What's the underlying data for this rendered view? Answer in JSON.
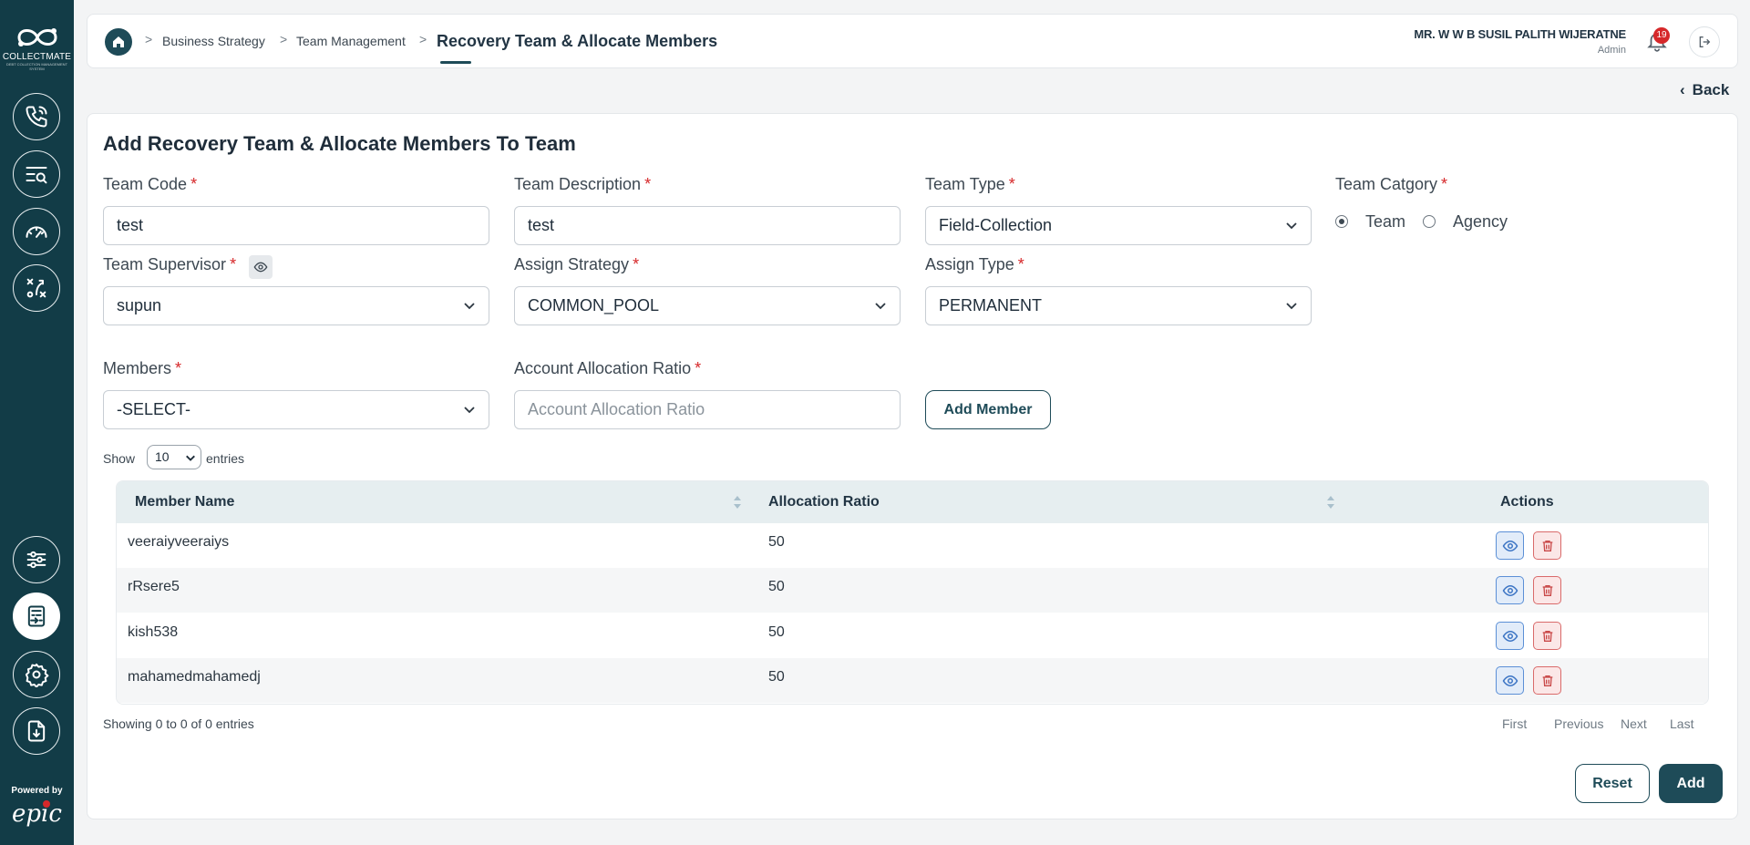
{
  "brand": {
    "name": "COLLECTMATE",
    "tagline": "DEBT COLLECTION MANAGEMENT SYSTEM",
    "powered_by": "Powered by",
    "vendor": "epic"
  },
  "breadcrumb": {
    "items": [
      "Business Strategy",
      "Team Management"
    ],
    "current": "Recovery Team & Allocate Members"
  },
  "user": {
    "name": "MR. W W B SUSIL PALITH WIJERATNE",
    "role": "Admin",
    "notifications": "19"
  },
  "back_label": "Back",
  "form": {
    "title": "Add Recovery Team & Allocate Members To Team",
    "team_code": {
      "label": "Team Code",
      "value": "test"
    },
    "team_description": {
      "label": "Team Description",
      "value": "test"
    },
    "team_type": {
      "label": "Team Type",
      "value": "Field-Collection"
    },
    "team_category": {
      "label": "Team Catgory",
      "options": [
        "Team",
        "Agency"
      ],
      "selected": "Team"
    },
    "team_supervisor": {
      "label": "Team Supervisor",
      "value": "supun"
    },
    "assign_strategy": {
      "label": "Assign Strategy",
      "value": "COMMON_POOL"
    },
    "assign_type": {
      "label": "Assign Type",
      "value": "PERMANENT"
    },
    "members": {
      "label": "Members",
      "value": "-SELECT-"
    },
    "allocation_ratio": {
      "label": "Account Allocation Ratio",
      "placeholder": "Account Allocation Ratio"
    },
    "add_member_label": "Add Member",
    "required_mark": "*"
  },
  "table": {
    "show_label": "Show",
    "page_size": "10",
    "entries_label": "entries",
    "columns": [
      "Member Name",
      "Allocation Ratio",
      "Actions"
    ],
    "rows": [
      {
        "member": "veeraiyveeraiys",
        "ratio": "50"
      },
      {
        "member": "rRsere5",
        "ratio": "50"
      },
      {
        "member": "kish538",
        "ratio": "50"
      },
      {
        "member": "mahamedmahamedj",
        "ratio": "50"
      }
    ],
    "info": "Showing 0 to 0 of 0 entries",
    "pagination": [
      "First",
      "Previous",
      "Next",
      "Last"
    ]
  },
  "actions": {
    "reset": "Reset",
    "add": "Add"
  },
  "colors": {
    "sidebar": "#123c47",
    "primary": "#1e4b58",
    "required": "#d6282a",
    "header_row": "#e6eef0"
  }
}
